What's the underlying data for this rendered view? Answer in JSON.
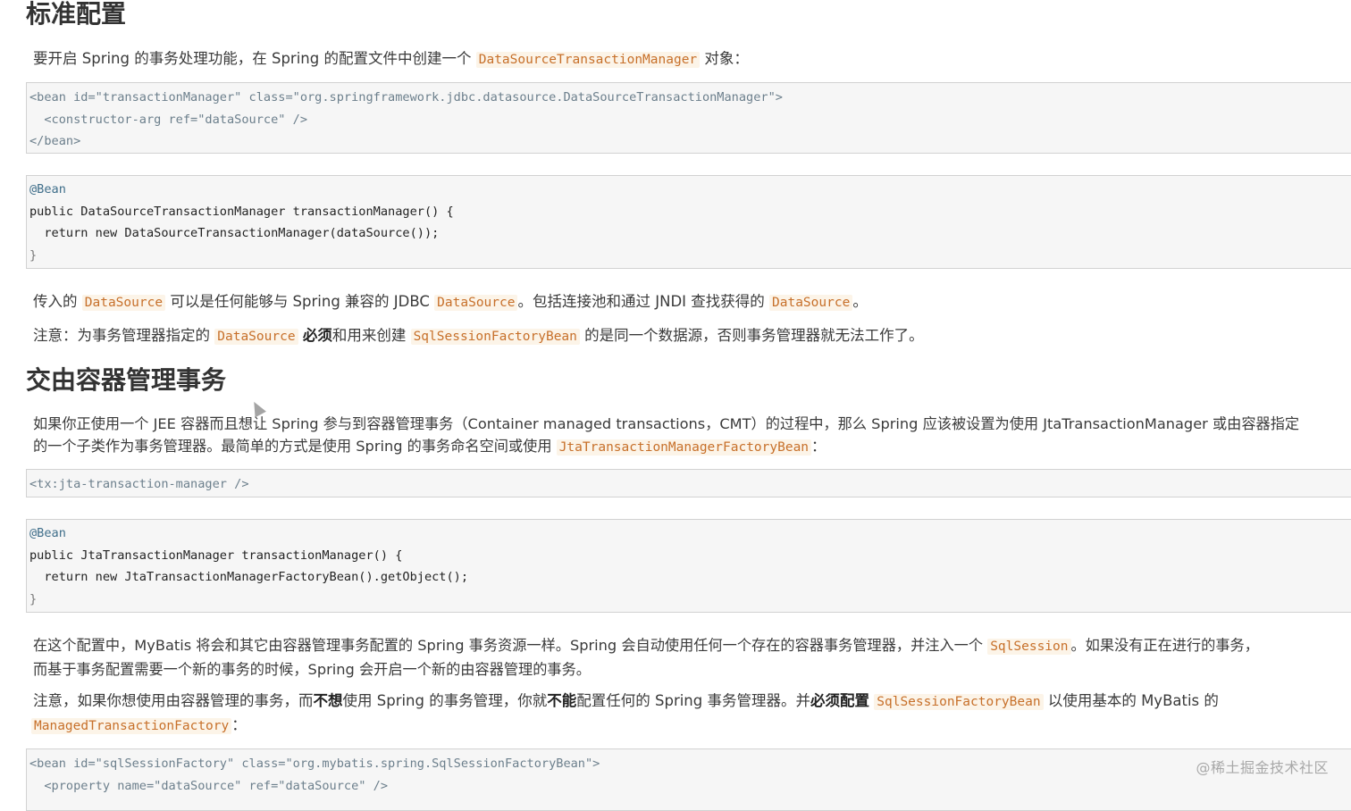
{
  "section1": {
    "heading": "标准配置",
    "intro": {
      "t1": "要开启 Spring 的事务处理功能，在 Spring 的配置文件中创建一个",
      "c1": "DataSourceTransactionManager",
      "t2": "对象："
    },
    "xml_code": {
      "lines": [
        "<bean id=\"transactionManager\" class=\"org.springframework.jdbc.datasource.DataSourceTransactionManager\">",
        "  <constructor-arg ref=\"dataSource\" />",
        "</bean>"
      ]
    },
    "java_code": {
      "annotation": "@Bean",
      "line2": "public DataSourceTransactionManager transactionManager() {",
      "line3": "  return new DataSourceTransactionManager(dataSource());",
      "line4": "}"
    },
    "para1": {
      "t1": "传入的",
      "c1": "DataSource",
      "t2": "可以是任何能够与 Spring 兼容的 JDBC",
      "c2": "DataSource",
      "t3": "。包括连接池和通过 JNDI 查找获得的",
      "c3": "DataSource",
      "t4": "。"
    },
    "para2": {
      "t1": "注意：为事务管理器指定的",
      "c1": "DataSource",
      "b1": "必须",
      "t2": "和用来创建",
      "c2": "SqlSessionFactoryBean",
      "t3": "的是同一个数据源，否则事务管理器就无法工作了。"
    }
  },
  "section2": {
    "heading": "交由容器管理事务",
    "para1": {
      "line1": "如果你正使用一个 JEE 容器而且想让 Spring 参与到容器管理事务（Container managed transactions，CMT）的过程中，那么 Spring 应该被设置为使用 JtaTransactionManager 或由容器指定",
      "line2_t1": "的一个子类作为事务管理器。最简单的方式是使用 Spring 的事务命名空间或使用",
      "line2_c1": "JtaTransactionManagerFactoryBean",
      "line2_t2": "："
    },
    "xml_code": {
      "line1": "<tx:jta-transaction-manager />"
    },
    "java_code": {
      "annotation": "@Bean",
      "line2": "public JtaTransactionManager transactionManager() {",
      "line3": "  return new JtaTransactionManagerFactoryBean().getObject();",
      "line4": "}"
    },
    "para2": {
      "line1_t1": "在这个配置中，MyBatis 将会和其它由容器管理事务配置的 Spring 事务资源一样。Spring 会自动使用任何一个存在的容器事务管理器，并注入一个",
      "line1_c1": "SqlSession",
      "line1_t2": "。如果没有正在进行的事务，",
      "line2": "而基于事务配置需要一个新的事务的时候，Spring 会开启一个新的由容器管理的事务。"
    },
    "para3": {
      "t1": "注意，如果你想使用由容器管理的事务，而",
      "b1": "不想",
      "t2": "使用 Spring 的事务管理，你就",
      "b2": "不能",
      "t3": "配置任何的 Spring 事务管理器。并",
      "b3": "必须配置",
      "c1": "SqlSessionFactoryBean",
      "t4": "以使用基本的 MyBatis 的",
      "c2": "ManagedTransactionFactory",
      "t5": "："
    },
    "xml_code2": {
      "line1": "<bean id=\"sqlSessionFactory\" class=\"org.mybatis.spring.SqlSessionFactoryBean\">",
      "line2": "  <property name=\"dataSource\" ref=\"dataSource\" />"
    }
  },
  "watermark": "@稀土掘金技术社区"
}
